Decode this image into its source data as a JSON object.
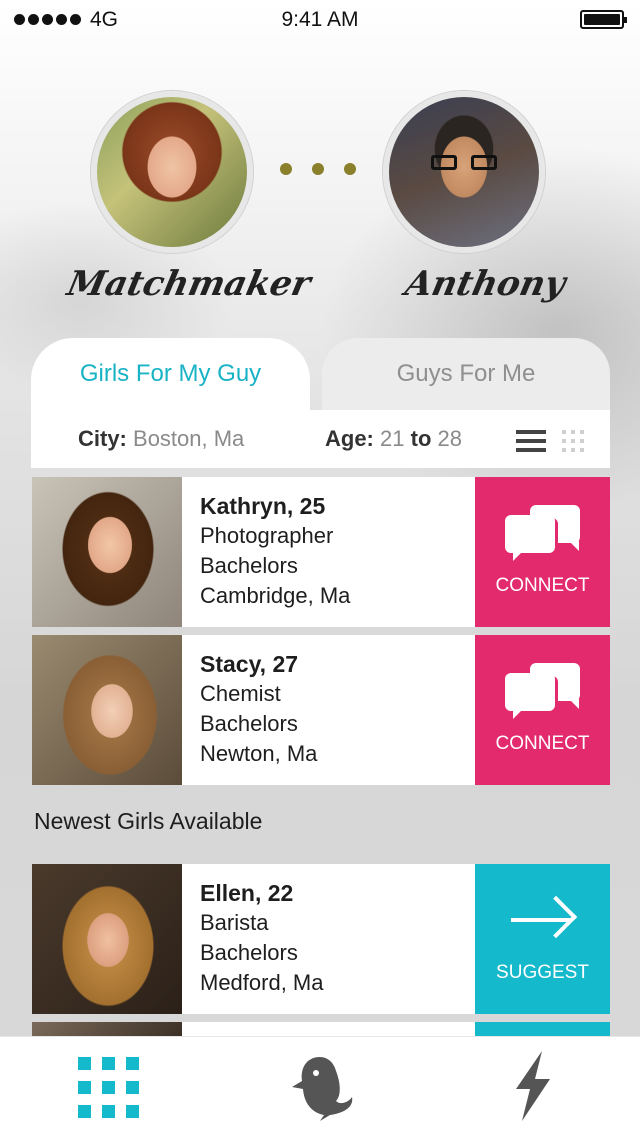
{
  "status_bar": {
    "network": "4G",
    "time": "9:41 AM"
  },
  "profiles": {
    "left_name": "Matchmaker",
    "right_name": "Anthony",
    "left_icon": "woman-avatar",
    "right_icon": "man-avatar"
  },
  "tabs": [
    {
      "label": "Girls For My Guy",
      "active": true
    },
    {
      "label": "Guys For Me",
      "active": false
    }
  ],
  "filter": {
    "city_label": "City:",
    "city_value": "Boston, Ma",
    "age_label": "Age:",
    "age_min": "21",
    "age_to": "to",
    "age_max": "28"
  },
  "matches": [
    {
      "name": "Kathryn, 25",
      "job": "Photographer",
      "education": "Bachelors",
      "location": "Cambridge, Ma",
      "action": "CONNECT"
    },
    {
      "name": "Stacy, 27",
      "job": "Chemist",
      "education": "Bachelors",
      "location": "Newton, Ma",
      "action": "CONNECT"
    }
  ],
  "section_title": "Newest Girls Available",
  "newest": [
    {
      "name": "Ellen, 22",
      "job": "Barista",
      "education": "Bachelors",
      "location": "Medford, Ma",
      "action": "SUGGEST"
    }
  ],
  "colors": {
    "accent": "#14b9cc",
    "connect": "#e22a6c",
    "suggest": "#14b9cc",
    "dots": "#8a7f2a"
  },
  "nav": [
    "grid-icon",
    "bird-icon",
    "lightning-icon"
  ]
}
